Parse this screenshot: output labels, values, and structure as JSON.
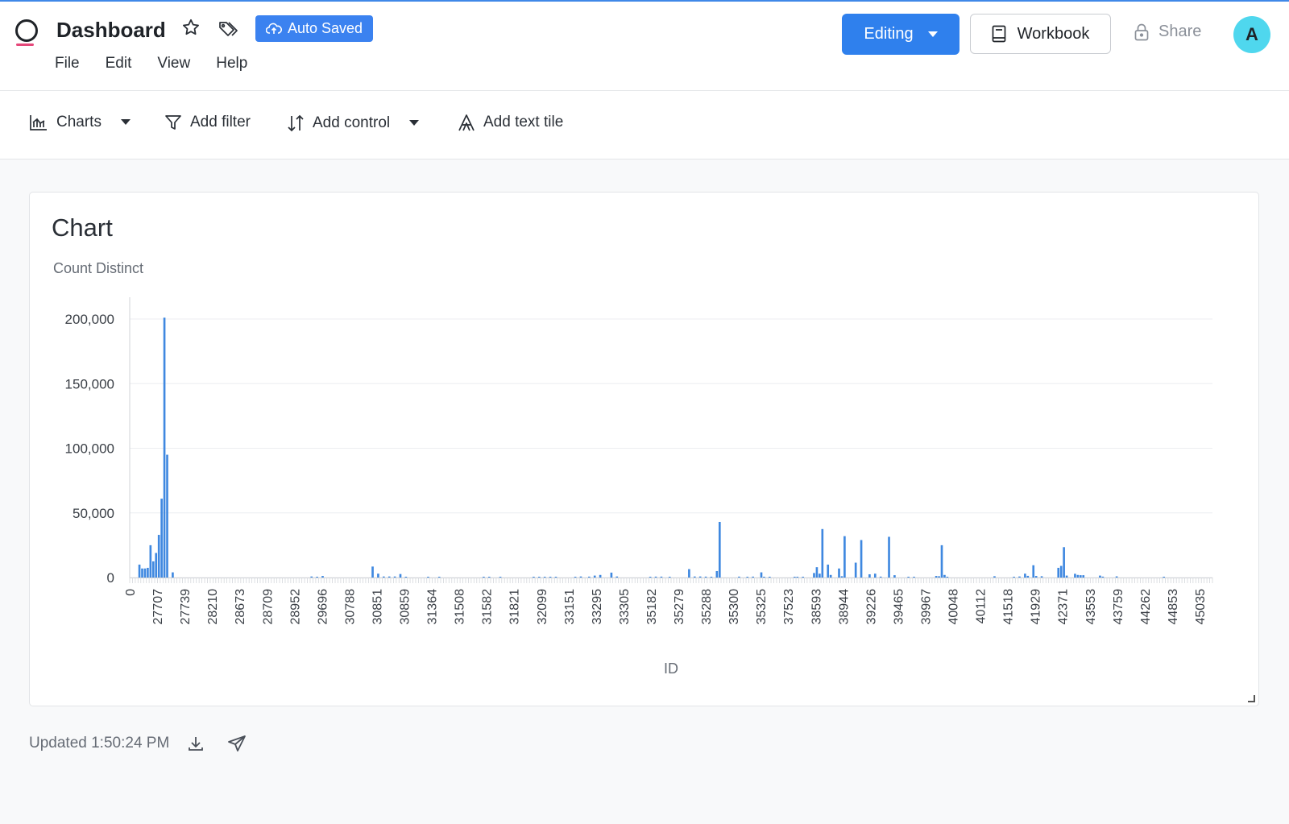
{
  "header": {
    "title": "Dashboard",
    "auto_saved": "Auto Saved",
    "menu": [
      "File",
      "Edit",
      "View",
      "Help"
    ],
    "editing": "Editing",
    "workbook": "Workbook",
    "share": "Share",
    "avatar": "A"
  },
  "toolbar": {
    "charts": "Charts",
    "add_filter": "Add filter",
    "add_control": "Add control",
    "add_text_tile": "Add text tile"
  },
  "card": {
    "title": "Chart",
    "subtitle": "Count Distinct"
  },
  "footer": {
    "updated": "Updated 1:50:24 PM"
  },
  "colors": {
    "accent": "#2f80ed",
    "bar": "#3f88e0",
    "avatar": "#4fd7ee"
  },
  "chart_data": {
    "type": "bar",
    "ylabel": "Count Distinct",
    "xlabel": "ID",
    "ylim": [
      0,
      200000
    ],
    "yticks": [
      0,
      50000,
      100000,
      150000,
      200000
    ],
    "xtick_labels": [
      "0",
      "27707",
      "27739",
      "28210",
      "28673",
      "28709",
      "28952",
      "29696",
      "30788",
      "30851",
      "30859",
      "31364",
      "31508",
      "31582",
      "31821",
      "32099",
      "33151",
      "33295",
      "33305",
      "35182",
      "35279",
      "35288",
      "35300",
      "35325",
      "37523",
      "38593",
      "38944",
      "39226",
      "39465",
      "39967",
      "40048",
      "40112",
      "41518",
      "41929",
      "42371",
      "43553",
      "43759",
      "44262",
      "44853",
      "45035"
    ],
    "bars": [
      [
        3,
        10000
      ],
      [
        4,
        7000
      ],
      [
        5,
        7000
      ],
      [
        6,
        7500
      ],
      [
        7,
        25000
      ],
      [
        8,
        12500
      ],
      [
        9,
        19000
      ],
      [
        10,
        33000
      ],
      [
        11,
        61000
      ],
      [
        12,
        201000
      ],
      [
        13,
        95000
      ],
      [
        15,
        4000
      ],
      [
        65,
        800
      ],
      [
        67,
        500
      ],
      [
        69,
        1200
      ],
      [
        87,
        8500
      ],
      [
        89,
        3000
      ],
      [
        91,
        800
      ],
      [
        93,
        800
      ],
      [
        95,
        800
      ],
      [
        97,
        2700
      ],
      [
        99,
        500
      ],
      [
        107,
        500
      ],
      [
        111,
        500
      ],
      [
        127,
        600
      ],
      [
        129,
        500
      ],
      [
        133,
        500
      ],
      [
        145,
        500
      ],
      [
        147,
        400
      ],
      [
        149,
        300
      ],
      [
        151,
        500
      ],
      [
        153,
        600
      ],
      [
        160,
        500
      ],
      [
        162,
        800
      ],
      [
        165,
        700
      ],
      [
        167,
        1500
      ],
      [
        169,
        2000
      ],
      [
        173,
        3800
      ],
      [
        175,
        800
      ],
      [
        187,
        600
      ],
      [
        189,
        700
      ],
      [
        191,
        700
      ],
      [
        194,
        300
      ],
      [
        201,
        6500
      ],
      [
        203,
        800
      ],
      [
        205,
        800
      ],
      [
        207,
        700
      ],
      [
        209,
        500
      ],
      [
        211,
        5000
      ],
      [
        212,
        43000
      ],
      [
        219,
        700
      ],
      [
        222,
        600
      ],
      [
        224,
        700
      ],
      [
        227,
        4000
      ],
      [
        228,
        400
      ],
      [
        230,
        400
      ],
      [
        239,
        500
      ],
      [
        240,
        500
      ],
      [
        242,
        500
      ],
      [
        246,
        3500
      ],
      [
        247,
        8000
      ],
      [
        248,
        3000
      ],
      [
        249,
        37500
      ],
      [
        251,
        10000
      ],
      [
        252,
        2000
      ],
      [
        255,
        7000
      ],
      [
        256,
        1000
      ],
      [
        257,
        32000
      ],
      [
        261,
        11500
      ],
      [
        263,
        29000
      ],
      [
        266,
        2500
      ],
      [
        268,
        3000
      ],
      [
        270,
        700
      ],
      [
        273,
        31500
      ],
      [
        275,
        1800
      ],
      [
        280,
        500
      ],
      [
        282,
        500
      ],
      [
        290,
        1200
      ],
      [
        291,
        1000
      ],
      [
        292,
        25000
      ],
      [
        293,
        2000
      ],
      [
        294,
        500
      ],
      [
        311,
        1000
      ],
      [
        318,
        500
      ],
      [
        320,
        800
      ],
      [
        322,
        3000
      ],
      [
        323,
        1300
      ],
      [
        325,
        9500
      ],
      [
        326,
        1200
      ],
      [
        328,
        1000
      ],
      [
        334,
        7500
      ],
      [
        335,
        9000
      ],
      [
        336,
        23500
      ],
      [
        337,
        1500
      ],
      [
        340,
        2900
      ],
      [
        341,
        2000
      ],
      [
        342,
        1800
      ],
      [
        343,
        1800
      ],
      [
        349,
        1500
      ],
      [
        350,
        700
      ],
      [
        355,
        900
      ],
      [
        372,
        500
      ]
    ]
  }
}
